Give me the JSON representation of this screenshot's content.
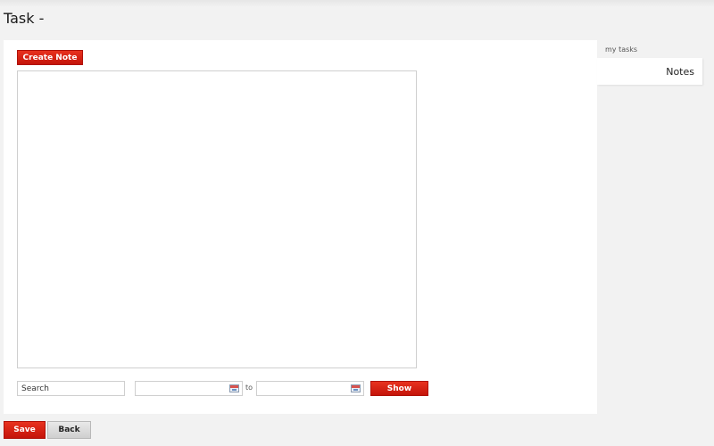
{
  "page": {
    "title": "Task -"
  },
  "toolbar": {
    "create_note_label": "Create Note"
  },
  "filters": {
    "search_value": "Search",
    "date_from_value": "",
    "date_to_value": "",
    "to_label": "to",
    "show_label": "Show"
  },
  "footer": {
    "save_label": "Save",
    "back_label": "Back"
  },
  "sidebar": {
    "section_label": "my tasks",
    "active_tab": "Notes"
  },
  "colors": {
    "accent": "#d3200f",
    "panel": "#ffffff",
    "background": "#f2f2f2"
  },
  "icons": {
    "date_picker": "calendar-icon"
  }
}
